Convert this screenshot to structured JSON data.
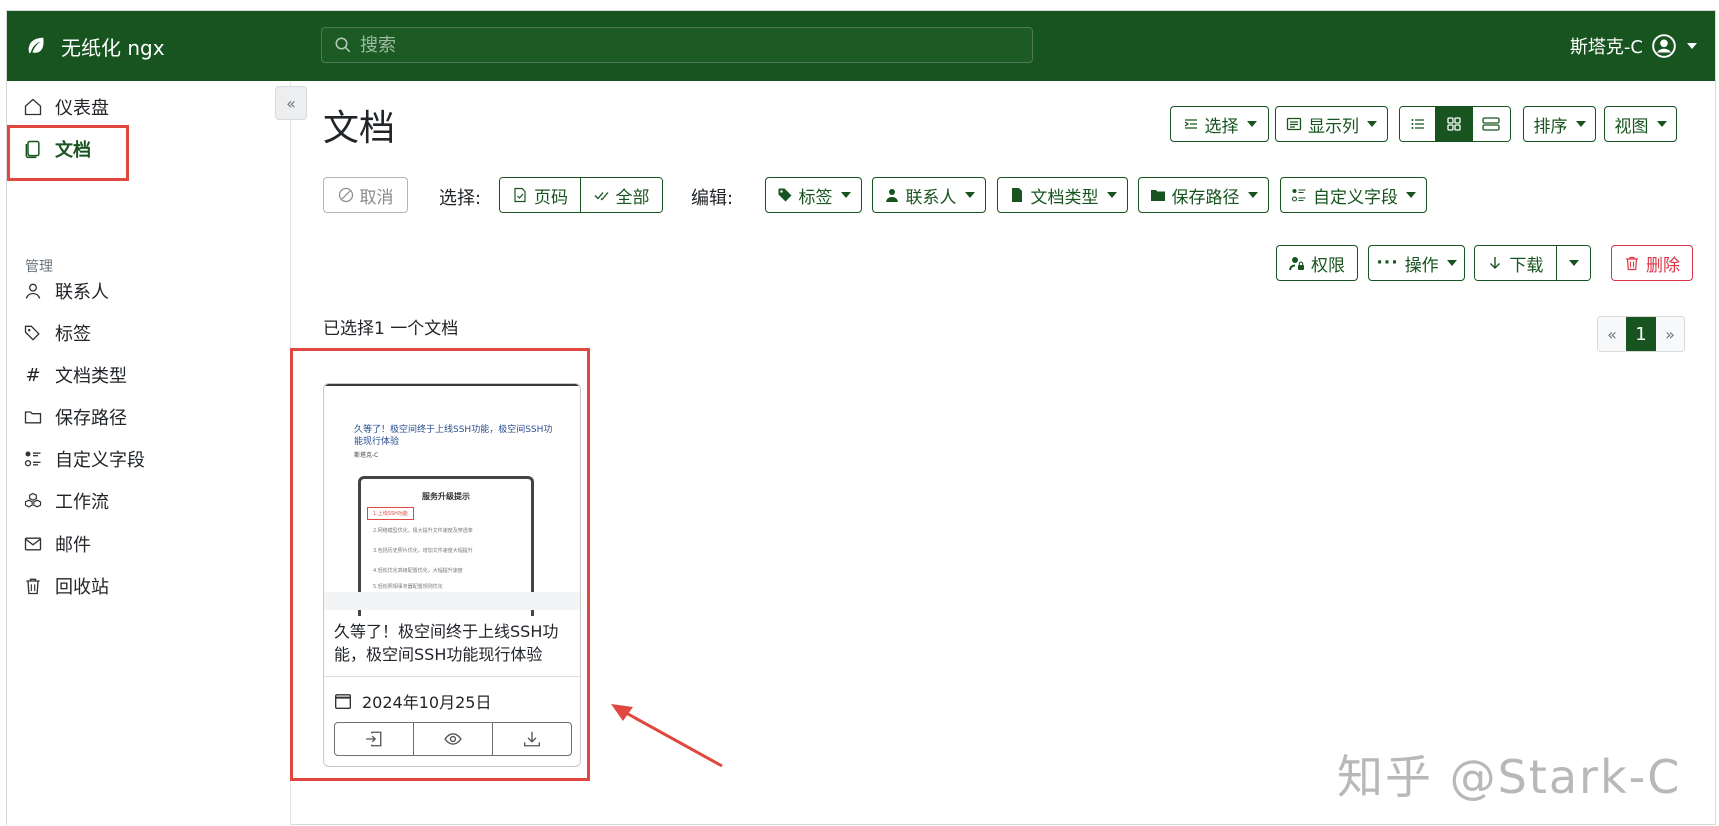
{
  "topbar": {
    "app_name": "无纸化 ngx",
    "search_placeholder": "搜索",
    "user_name": "斯塔克-C",
    "bg_color": "#17541f"
  },
  "sidebar": {
    "items": [
      {
        "label": "仪表盘",
        "icon": "house-icon"
      },
      {
        "label": "文档",
        "icon": "documents-icon",
        "active": true
      }
    ],
    "section_label": "管理",
    "manage_items": [
      {
        "label": "联系人",
        "icon": "person-icon"
      },
      {
        "label": "标签",
        "icon": "tags-icon"
      },
      {
        "label": "文档类型",
        "icon": "hash-icon"
      },
      {
        "label": "保存路径",
        "icon": "folder-icon"
      },
      {
        "label": "自定义字段",
        "icon": "ui-radios-icon"
      },
      {
        "label": "工作流",
        "icon": "boxes-icon"
      },
      {
        "label": "邮件",
        "icon": "envelope-icon"
      },
      {
        "label": "回收站",
        "icon": "trash-icon"
      }
    ]
  },
  "page": {
    "title": "文档",
    "toolbar_right": {
      "select": "选择",
      "show_columns": "显示列",
      "sort": "排序",
      "views": "视图"
    },
    "bulk": {
      "cancel": "取消",
      "select_label": "选择:",
      "page": "页码",
      "all": "全部",
      "edit_label": "编辑:",
      "tags": "标签",
      "correspondent": "联系人",
      "doc_type": "文档类型",
      "storage_path": "保存路径",
      "custom_fields": "自定义字段"
    },
    "actions": {
      "permissions": "权限",
      "actions": "操作",
      "download": "下载",
      "delete": "删除"
    },
    "selection_text": "已选择1 一个文档",
    "pager": {
      "prev": "«",
      "current": "1",
      "next": "»"
    }
  },
  "document": {
    "title": "久等了！极空间终于上线SSH功能，极空间SSH功能现行体验",
    "date": "2024年10月25日",
    "thumb_heading": "久等了！极空间终于上线SSH功能，极空间SSH功能现行体验",
    "thumb_sub": "斯塔克-C",
    "thumb_box_title": "服务升级提示",
    "thumb_lines": [
      "1.上线SSH功能",
      "2.网络模型优化，极大提升文件速度及穿透率",
      "3.包括历史照片优化，增加文件速度大幅提升",
      "4.轻松优化高级配置优化，大幅提升速度",
      "5.轻松照相事务器配置规则优化"
    ]
  },
  "watermark": "知乎 @Stark-C"
}
